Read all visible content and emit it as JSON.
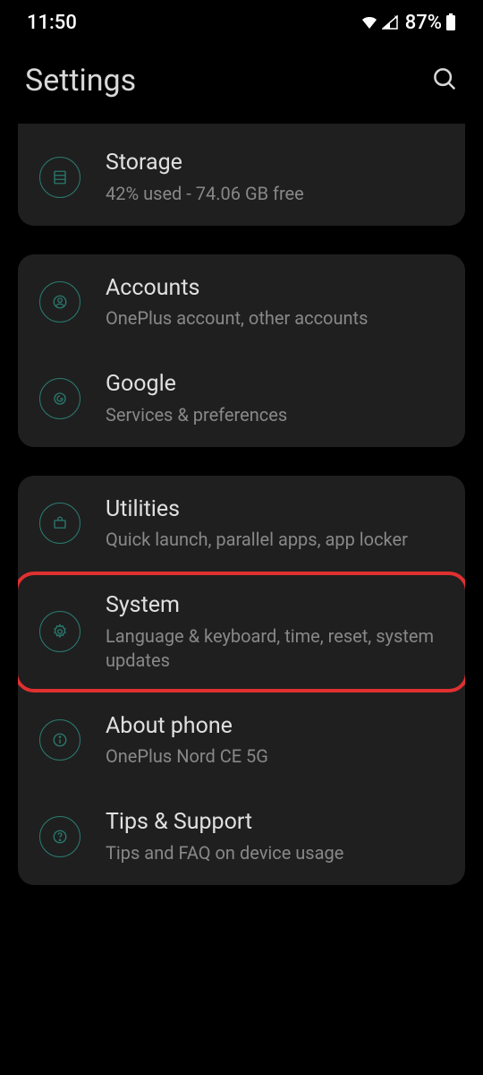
{
  "status": {
    "time": "11:50",
    "battery": "87%"
  },
  "header": {
    "title": "Settings"
  },
  "groups": [
    {
      "items": [
        {
          "title": "Storage",
          "sub": "42% used - 74.06 GB free"
        }
      ]
    },
    {
      "items": [
        {
          "title": "Accounts",
          "sub": "OnePlus account, other accounts"
        },
        {
          "title": "Google",
          "sub": "Services & preferences"
        }
      ]
    },
    {
      "items": [
        {
          "title": "Utilities",
          "sub": "Quick launch, parallel apps, app locker"
        },
        {
          "title": "System",
          "sub": "Language & keyboard, time, reset, system updates",
          "highlighted": true
        },
        {
          "title": "About phone",
          "sub": "OnePlus Nord CE 5G"
        },
        {
          "title": "Tips & Support",
          "sub": "Tips and FAQ on device usage"
        }
      ]
    }
  ]
}
